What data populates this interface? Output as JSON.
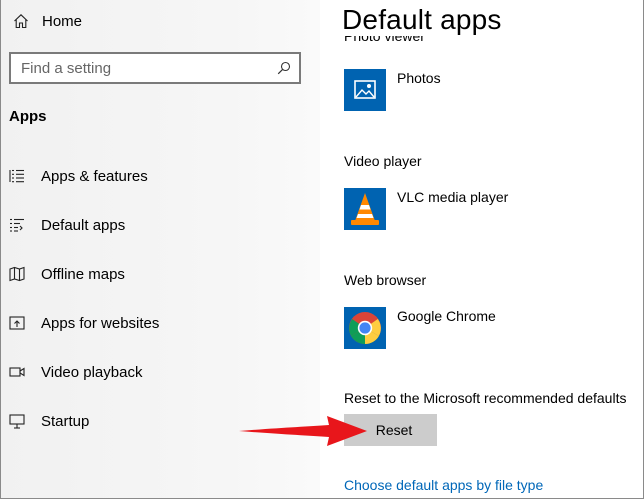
{
  "sidebar": {
    "home_label": "Home",
    "search": {
      "placeholder": "Find a setting"
    },
    "section_title": "Apps",
    "items": [
      {
        "label": "Apps & features",
        "icon": "list-icon"
      },
      {
        "label": "Default apps",
        "icon": "default-apps-icon"
      },
      {
        "label": "Offline maps",
        "icon": "map-icon"
      },
      {
        "label": "Apps for websites",
        "icon": "open-in-icon"
      },
      {
        "label": "Video playback",
        "icon": "video-icon"
      },
      {
        "label": "Startup",
        "icon": "startup-icon"
      }
    ]
  },
  "main": {
    "title": "Default apps",
    "photo_viewer_label": "Photo viewer",
    "photo_app": "Photos",
    "video_player_label": "Video player",
    "video_app": "VLC media player",
    "web_browser_label": "Web browser",
    "browser_app": "Google Chrome",
    "reset_label": "Reset to the Microsoft recommended defaults",
    "reset_button": "Reset",
    "file_type_link": "Choose default apps by file type"
  },
  "colors": {
    "accent": "#0067b8",
    "photos_tile": "#0063b1",
    "arrow": "#e8161b",
    "sidebar_bg": "#f2f2f2",
    "button_bg": "#cccccc"
  }
}
